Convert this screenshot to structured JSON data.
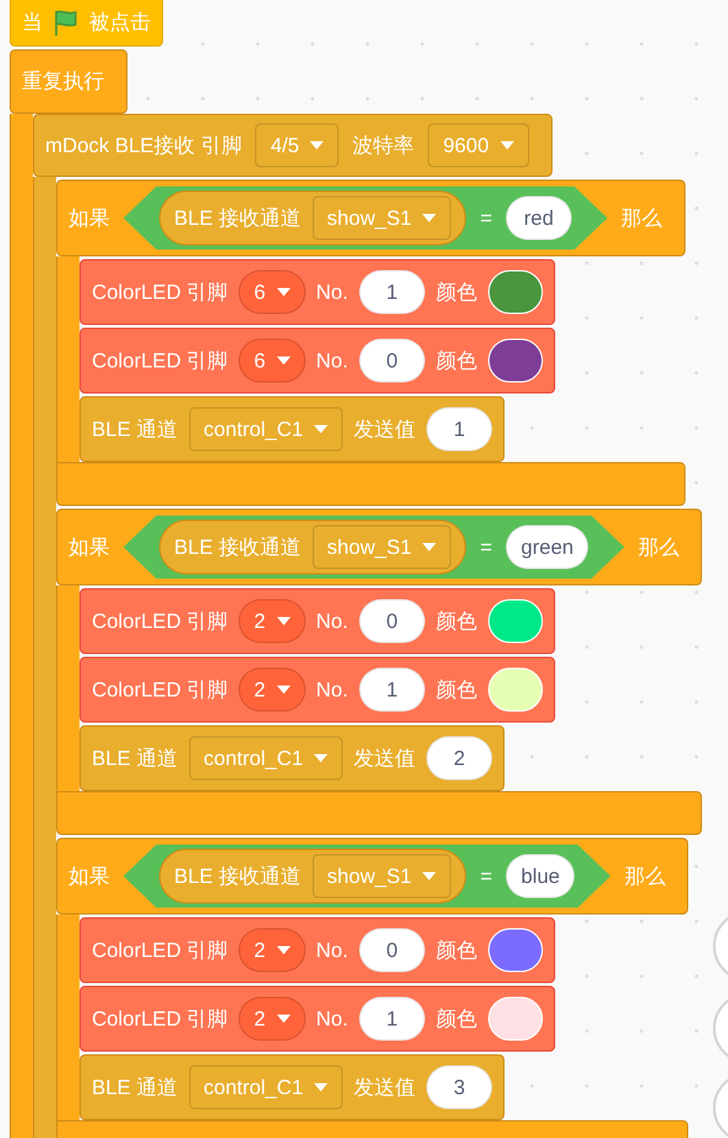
{
  "hat": {
    "before": "当",
    "after": "被点击"
  },
  "forever": {
    "label": "重复执行"
  },
  "serial": {
    "label": "mDock BLE接收 引脚",
    "pin": "4/5",
    "baud_label": "波特率",
    "baud": "9600"
  },
  "ifs": [
    {
      "label": "如果",
      "condition": {
        "reporter": "BLE 接收通道",
        "channel": "show_S1",
        "operator": "=",
        "value": "red"
      },
      "then": "那么",
      "body": [
        {
          "kind": "colorled",
          "label": "ColorLED 引脚",
          "pin": "6",
          "no_label": "No.",
          "no": "1",
          "color_label": "颜色",
          "color": "#4a953d"
        },
        {
          "kind": "colorled",
          "label": "ColorLED 引脚",
          "pin": "6",
          "no_label": "No.",
          "no": "0",
          "color_label": "颜色",
          "color": "#7e3d96"
        },
        {
          "kind": "ble_send",
          "label": "BLE 通道",
          "channel": "control_C1",
          "send_label": "发送值",
          "value": "1"
        }
      ]
    },
    {
      "label": "如果",
      "condition": {
        "reporter": "BLE 接收通道",
        "channel": "show_S1",
        "operator": "=",
        "value": "green"
      },
      "then": "那么",
      "body": [
        {
          "kind": "colorled",
          "label": "ColorLED 引脚",
          "pin": "2",
          "no_label": "No.",
          "no": "0",
          "color_label": "颜色",
          "color": "#00e887"
        },
        {
          "kind": "colorled",
          "label": "ColorLED 引脚",
          "pin": "2",
          "no_label": "No.",
          "no": "1",
          "color_label": "颜色",
          "color": "#e6ffb3"
        },
        {
          "kind": "ble_send",
          "label": "BLE 通道",
          "channel": "control_C1",
          "send_label": "发送值",
          "value": "2"
        }
      ]
    },
    {
      "label": "如果",
      "condition": {
        "reporter": "BLE 接收通道",
        "channel": "show_S1",
        "operator": "=",
        "value": "blue"
      },
      "then": "那么",
      "body": [
        {
          "kind": "colorled",
          "label": "ColorLED 引脚",
          "pin": "2",
          "no_label": "No.",
          "no": "0",
          "color_label": "颜色",
          "color": "#7b6cff"
        },
        {
          "kind": "colorled",
          "label": "ColorLED 引脚",
          "pin": "2",
          "no_label": "No.",
          "no": "1",
          "color_label": "颜色",
          "color": "#ffe0e4"
        },
        {
          "kind": "ble_send",
          "label": "BLE 通道",
          "channel": "control_C1",
          "send_label": "发送值",
          "value": "3"
        }
      ]
    }
  ]
}
